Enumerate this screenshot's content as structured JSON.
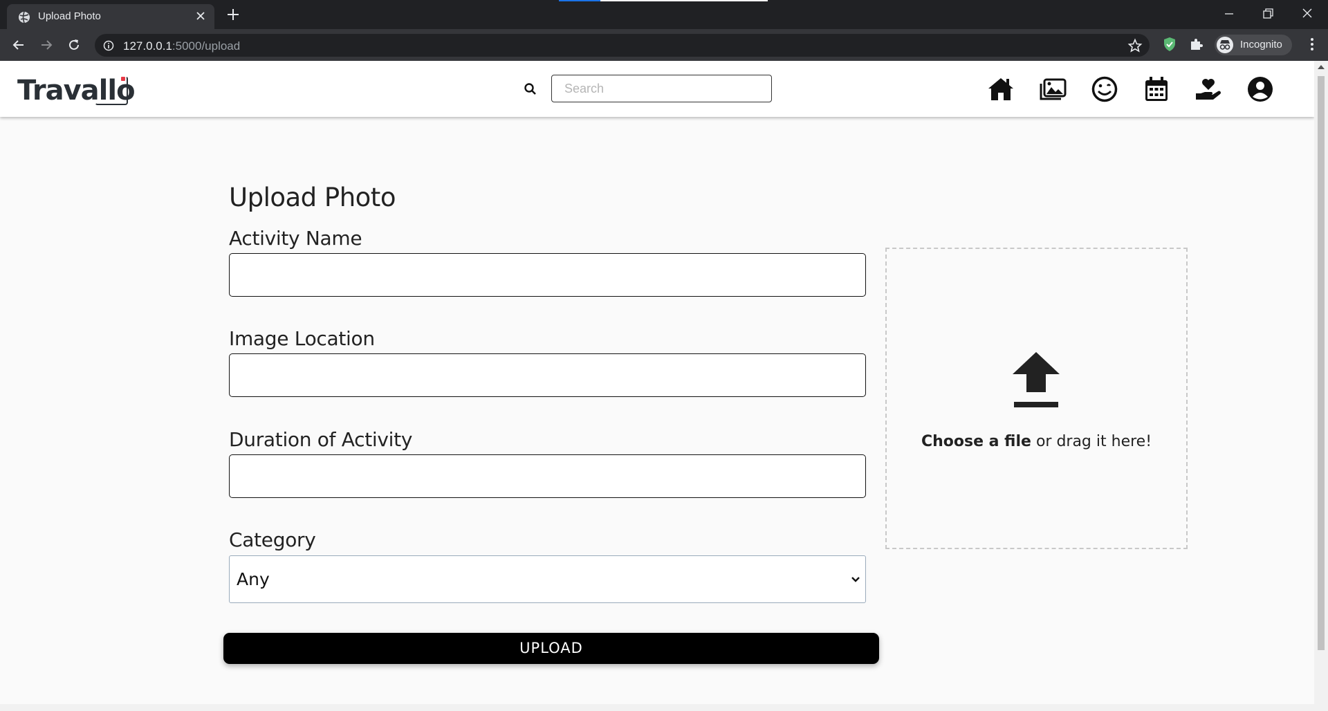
{
  "browser": {
    "tab_title": "Upload Photo",
    "url_host": "127.0.0.1",
    "url_path": ":5000/upload",
    "profile_label": "Incognito",
    "icons": [
      "globe-icon",
      "close-icon",
      "plus-icon",
      "back-icon",
      "forward-icon",
      "reload-icon",
      "info-icon",
      "star-icon",
      "shield-extension-icon",
      "puzzle-icon",
      "incognito-icon",
      "menu-icon"
    ]
  },
  "navbar": {
    "logo_text": "Travallo",
    "search_placeholder": "Search",
    "icons": [
      "home-icon",
      "gallery-icon",
      "smile-icon",
      "calendar-icon",
      "hand-heart-icon",
      "account-icon"
    ]
  },
  "form": {
    "title": "Upload Photo",
    "activity_name_label": "Activity Name",
    "activity_name_value": "",
    "image_location_label": "Image Location",
    "image_location_value": "",
    "duration_label": "Duration of Activity",
    "duration_value": "",
    "category_label": "Category",
    "category_value": "Any",
    "upload_label": "UPLOAD"
  },
  "dropzone": {
    "choose_text": "Choose a file",
    "drag_text": " or drag it here!"
  },
  "colors": {
    "chrome_dark": "#202124",
    "chrome_toolbar": "#35363a",
    "page_bg": "#fafafa",
    "button_bg": "#000000",
    "logo_accent": "#e63946"
  }
}
